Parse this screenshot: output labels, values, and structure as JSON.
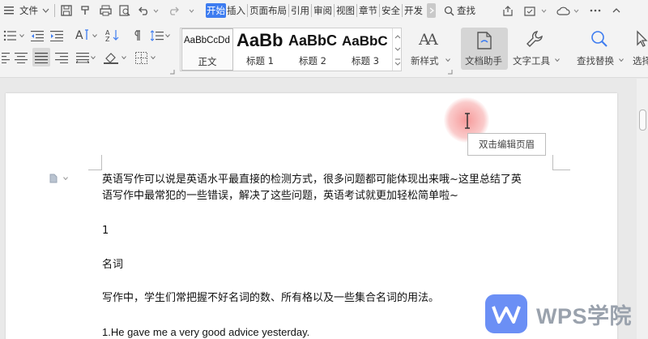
{
  "menubar": {
    "file_label": "文件",
    "tabs": [
      "开始",
      "插入",
      "页面布局",
      "引用",
      "审阅",
      "视图",
      "章节",
      "安全",
      "开发"
    ],
    "active_tab": "开始",
    "search_label": "查找"
  },
  "ribbon": {
    "styles": [
      {
        "sample": "AaBbCcDd",
        "name": "正文"
      },
      {
        "sample": "AaBb",
        "name": "标题 1"
      },
      {
        "sample": "AaBbC",
        "name": "标题 2"
      },
      {
        "sample": "AaBbC",
        "name": "标题 3"
      }
    ],
    "new_style_label": "新样式",
    "doc_assistant_label": "文档助手",
    "text_tools_label": "文字工具",
    "find_replace_label": "查找替换",
    "select_label": "选择"
  },
  "document": {
    "header_tooltip": "双击编辑页眉",
    "lines": [
      "英语写作可以说是英语水平最直接的检测方式，很多问题都可能体现出来哦~这里总结了英",
      "语写作中最常犯的一些错误，解决了这些问题，英语考试就更加轻松简单啦~",
      "1",
      "名词",
      "写作中，学生们常把握不好名词的数、所有格以及一些集合名词的用法。",
      "1.He gave me a very good advice yesterday."
    ]
  },
  "watermark": {
    "text": "WPS学院",
    "color": "#9aa2ad"
  },
  "colors": {
    "accent": "#3d7cf0",
    "logo_blue": "#6b8ff5"
  }
}
